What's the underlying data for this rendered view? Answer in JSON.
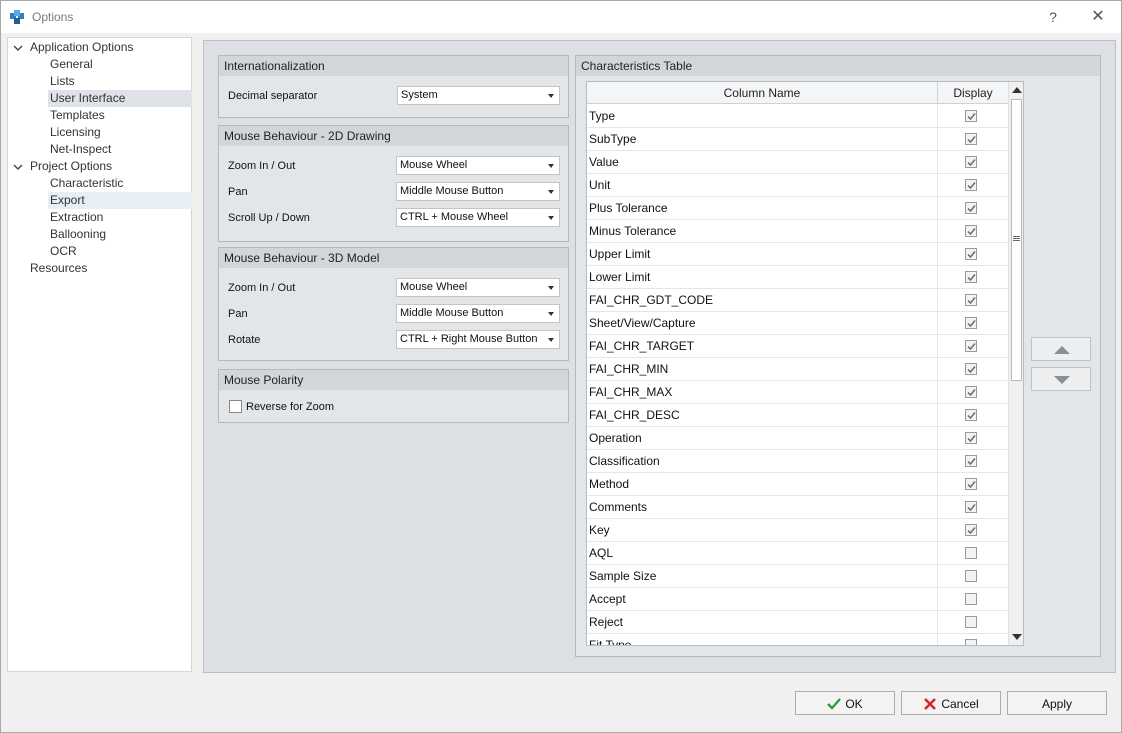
{
  "window": {
    "title": "Options",
    "help": "?",
    "close": "✕"
  },
  "tree": {
    "application_options": "Application Options",
    "general": "General",
    "lists": "Lists",
    "user_interface": "User Interface",
    "templates": "Templates",
    "licensing": "Licensing",
    "net_inspect": "Net-Inspect",
    "project_options": "Project Options",
    "characteristic": "Characteristic",
    "export": "Export",
    "extraction": "Extraction",
    "ballooning": "Ballooning",
    "ocr": "OCR",
    "resources": "Resources"
  },
  "intl": {
    "title": "Internationalization",
    "decimal_label": "Decimal separator",
    "decimal_value": "System"
  },
  "mouse2d": {
    "title": "Mouse Behaviour - 2D Drawing",
    "zoom_label": "Zoom In / Out",
    "zoom_value": "Mouse Wheel",
    "pan_label": "Pan",
    "pan_value": "Middle Mouse Button",
    "scroll_label": "Scroll Up / Down",
    "scroll_value": "CTRL + Mouse Wheel"
  },
  "mouse3d": {
    "title": "Mouse Behaviour - 3D Model",
    "zoom_label": "Zoom In / Out",
    "zoom_value": "Mouse Wheel",
    "pan_label": "Pan",
    "pan_value": "Middle Mouse Button",
    "rotate_label": "Rotate",
    "rotate_value": "CTRL + Right Mouse Button"
  },
  "polarity": {
    "title": "Mouse Polarity",
    "reverse_label": "Reverse for Zoom",
    "reverse_checked": false
  },
  "table": {
    "title": "Characteristics Table",
    "col_name": "Column Name",
    "col_display": "Display",
    "rows": [
      {
        "name": "Type",
        "checked": true
      },
      {
        "name": "SubType",
        "checked": true
      },
      {
        "name": "Value",
        "checked": true
      },
      {
        "name": "Unit",
        "checked": true
      },
      {
        "name": "Plus Tolerance",
        "checked": true
      },
      {
        "name": "Minus Tolerance",
        "checked": true
      },
      {
        "name": "Upper Limit",
        "checked": true
      },
      {
        "name": "Lower Limit",
        "checked": true
      },
      {
        "name": "FAI_CHR_GDT_CODE",
        "checked": true
      },
      {
        "name": "Sheet/View/Capture",
        "checked": true
      },
      {
        "name": "FAI_CHR_TARGET",
        "checked": true
      },
      {
        "name": "FAI_CHR_MIN",
        "checked": true
      },
      {
        "name": "FAI_CHR_MAX",
        "checked": true
      },
      {
        "name": "FAI_CHR_DESC",
        "checked": true
      },
      {
        "name": "Operation",
        "checked": true
      },
      {
        "name": "Classification",
        "checked": true
      },
      {
        "name": "Method",
        "checked": true
      },
      {
        "name": "Comments",
        "checked": true
      },
      {
        "name": "Key",
        "checked": true
      },
      {
        "name": "AQL",
        "checked": false
      },
      {
        "name": "Sample Size",
        "checked": false
      },
      {
        "name": "Accept",
        "checked": false
      },
      {
        "name": "Reject",
        "checked": false
      },
      {
        "name": "Fit Type",
        "checked": false
      }
    ]
  },
  "buttons": {
    "ok": "OK",
    "cancel": "Cancel",
    "apply": "Apply"
  },
  "icons": {
    "app": "puzzle-gear-icon",
    "ok": "check-icon",
    "cancel": "x-icon",
    "move_up": "triangle-up-icon",
    "move_down": "triangle-down-icon"
  },
  "colors": {
    "ok_check": "#2e9e3e",
    "cancel_x": "#d9232d",
    "selection": "#dfe3e8"
  }
}
